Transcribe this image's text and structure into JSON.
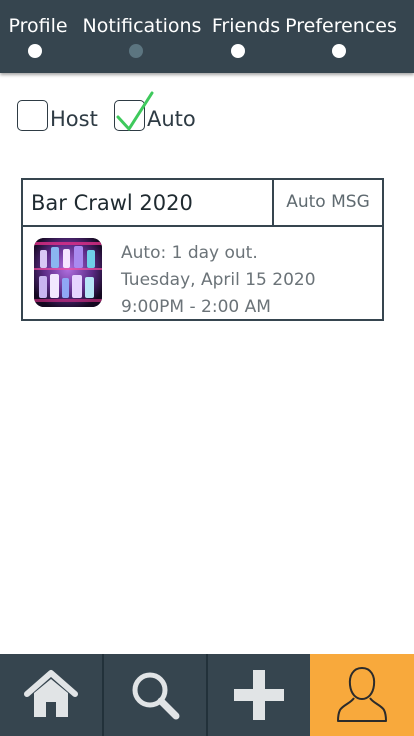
{
  "top_tabs": [
    {
      "label": "Profile",
      "active": false
    },
    {
      "label": "Notifications",
      "active": true
    },
    {
      "label": "Friends",
      "active": false
    },
    {
      "label": "Preferences",
      "active": false
    }
  ],
  "filters": {
    "host": {
      "label": "Host",
      "checked": false
    },
    "auto": {
      "label": "Auto",
      "checked": true
    }
  },
  "event_card": {
    "title": "Bar Crawl 2020",
    "action_label": "Auto MSG",
    "line1": "Auto: 1 day out.",
    "line2": "Tuesday, April 15 2020",
    "line3": "9:00PM - 2:00 AM"
  },
  "bottom_nav": [
    {
      "icon": "home-icon",
      "active": false
    },
    {
      "icon": "search-icon",
      "active": false
    },
    {
      "icon": "plus-icon",
      "active": false
    },
    {
      "icon": "profile-icon",
      "active": true
    }
  ],
  "colors": {
    "bar": "#36454f",
    "active_nav": "#f8a93c",
    "check": "#3ec95c",
    "active_dot": "#5c7580"
  }
}
